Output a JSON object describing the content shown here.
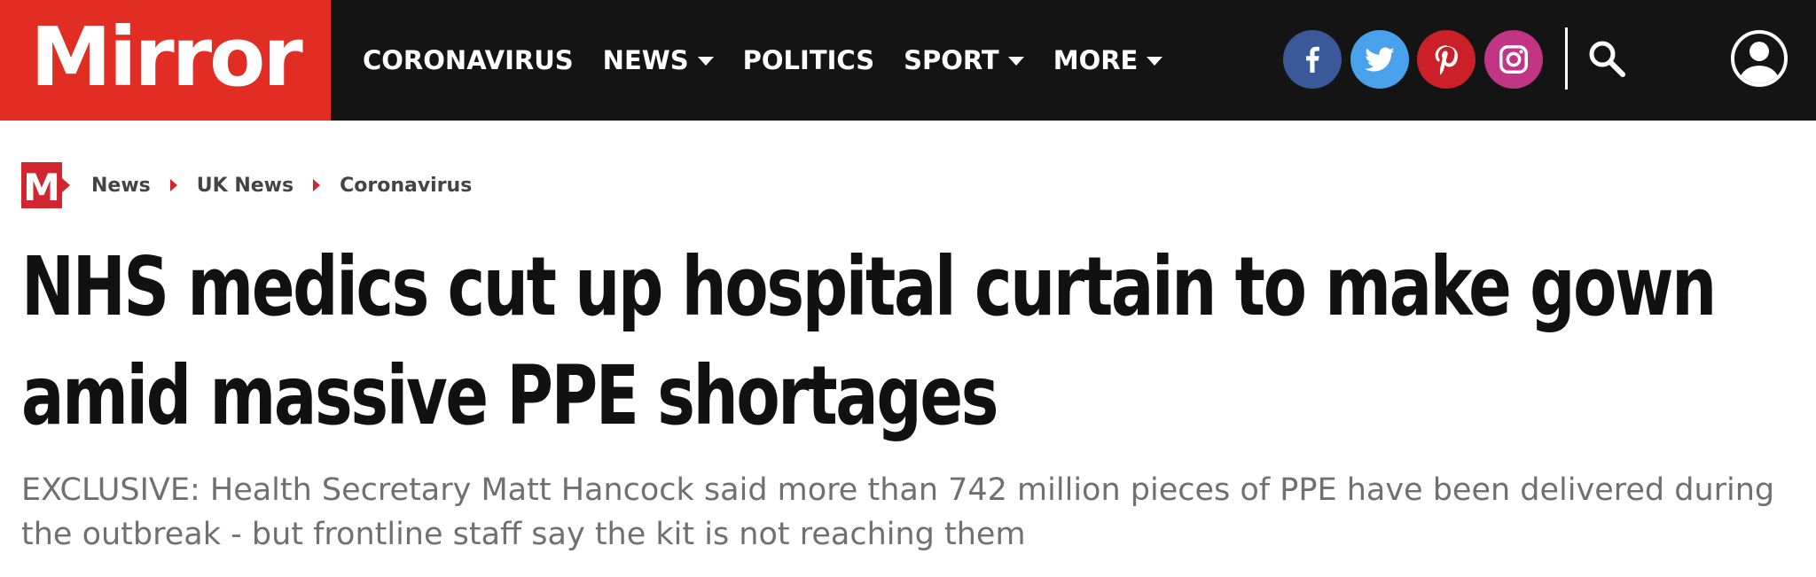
{
  "brand": {
    "logo_text": "Mirror",
    "accent": "#e12d24",
    "nav_bg": "#141414"
  },
  "nav": {
    "items": [
      {
        "label": "CORONAVIRUS",
        "dropdown": false
      },
      {
        "label": "NEWS",
        "dropdown": true
      },
      {
        "label": "POLITICS",
        "dropdown": false
      },
      {
        "label": "SPORT",
        "dropdown": true
      },
      {
        "label": "MORE",
        "dropdown": true
      }
    ],
    "social": [
      {
        "icon": "facebook-icon",
        "color": "#3b5998"
      },
      {
        "icon": "twitter-icon",
        "color": "#4aa1eb"
      },
      {
        "icon": "pinterest-icon",
        "color": "#cb2027"
      },
      {
        "icon": "instagram-icon",
        "color": "#c13584"
      }
    ],
    "search_icon": "search-icon",
    "account_icon": "user-icon"
  },
  "breadcrumb": {
    "badge_letter": "M",
    "items": [
      "News",
      "UK News",
      "Coronavirus"
    ]
  },
  "article": {
    "headline": "NHS medics cut up hospital curtain to make gown amid massive PPE shortages",
    "standfirst": "EXCLUSIVE: Health Secretary Matt Hancock said more than 742 million pieces of PPE have been delivered during the outbreak - but frontline staff say the kit is not reaching them"
  }
}
